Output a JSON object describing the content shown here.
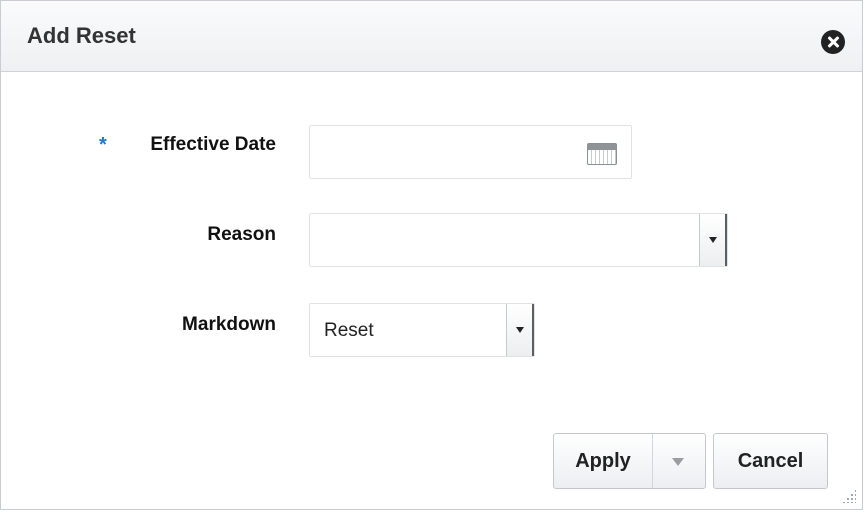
{
  "dialog": {
    "title": "Add Reset"
  },
  "form": {
    "required_marker": "*",
    "effective_date": {
      "label": "Effective Date",
      "value": "",
      "icon": "calendar-icon"
    },
    "reason": {
      "label": "Reason",
      "value": ""
    },
    "markdown": {
      "label": "Markdown",
      "value": "Reset"
    }
  },
  "buttons": {
    "apply": "Apply",
    "cancel": "Cancel"
  }
}
